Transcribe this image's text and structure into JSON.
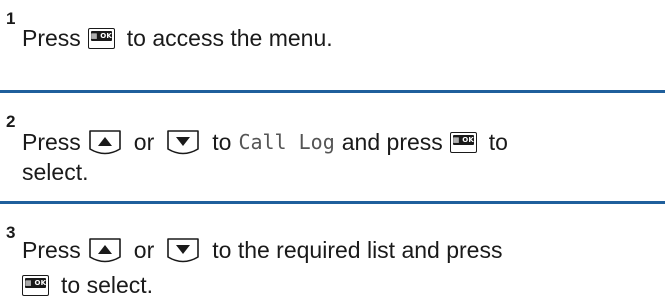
{
  "steps": [
    {
      "number": "1",
      "lines": [
        {
          "text_before": "Press",
          "text_after": "to access the menu."
        }
      ]
    },
    {
      "number": "2",
      "lines": [
        {
          "press": "Press",
          "or": "or",
          "to": "to",
          "menu_item": "Call Log",
          "and_press": "and press",
          "to_end": "to"
        },
        {
          "text": "select."
        }
      ]
    },
    {
      "number": "3",
      "lines": [
        {
          "press": "Press",
          "or": "or",
          "rest": "to the required list and press"
        },
        {
          "text": "to select."
        }
      ]
    }
  ],
  "colors": {
    "divider": "#1f5f9c",
    "text": "#1a1a1a"
  },
  "icons": {
    "menu_ok": "menu-ok-button-icon",
    "up": "up-arrow-button-icon",
    "down": "down-arrow-button-icon"
  }
}
